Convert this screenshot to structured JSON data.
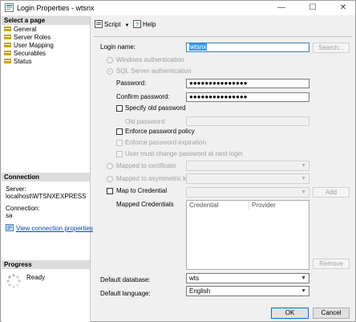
{
  "window": {
    "title": "Login Properties - wtsnx",
    "minimize": "—",
    "maximize": "☐",
    "close": "✕"
  },
  "left": {
    "select_page_heading": "Select a page",
    "pages": [
      "General",
      "Server Roles",
      "User Mapping",
      "Securables",
      "Status"
    ],
    "connection_heading": "Connection",
    "server_label": "Server:",
    "server_value": "localhost\\WTSNXEXPRESS",
    "connection_label": "Connection:",
    "connection_value": "sa",
    "view_connection_link": "View connection properties",
    "progress_heading": "Progress",
    "progress_status": "Ready"
  },
  "toolbar": {
    "script_label": "Script",
    "help_label": "Help"
  },
  "form": {
    "login_name_label": "Login name:",
    "login_name_value": "wtsnx",
    "search_button": "Search...",
    "windows_auth_label": "Windows authentication",
    "sql_auth_label": "SQL Server authentication",
    "password_label": "Password:",
    "password_value": "●●●●●●●●●●●●●●●",
    "confirm_password_label": "Confirm password:",
    "confirm_password_value": "●●●●●●●●●●●●●●●",
    "specify_old_password_label": "Specify old password",
    "old_password_label": "Old password:",
    "enforce_policy_label": "Enforce password policy",
    "enforce_expiration_label": "Enforce password expiration",
    "must_change_label": "User must change password at next login",
    "mapped_cert_label": "Mapped to certificate",
    "mapped_asym_label": "Mapped to asymmetric key",
    "map_credential_label": "Map to Credential",
    "add_button": "Add",
    "mapped_credentials_label": "Mapped Credentials",
    "credentials_columns": [
      "Credential",
      "Provider"
    ],
    "remove_button": "Remove",
    "default_database_label": "Default database:",
    "default_database_value": "wts",
    "default_language_label": "Default language:",
    "default_language_value": "English"
  },
  "buttons": {
    "ok": "OK",
    "cancel": "Cancel"
  },
  "colors": {
    "accent": "#0078d7",
    "link": "#0645ad",
    "selection": "#3399ff"
  }
}
